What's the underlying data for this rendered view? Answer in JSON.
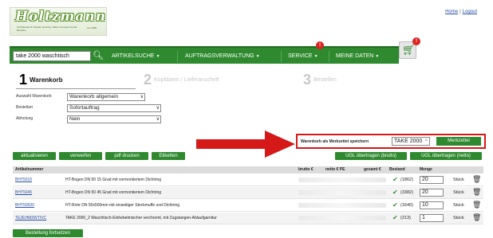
{
  "header": {
    "logo_text": "Holtzmann",
    "logo_tagline": "Großhandel für Sanitär, Heizung, Kälte und angrenzende Bereiche",
    "logo_year": "seit 1886",
    "links": {
      "home": "Home",
      "logout": "Logout"
    }
  },
  "nav": {
    "search_value": "take 2000 waschtisch",
    "items": [
      {
        "label": "ARTIKELSUCHE"
      },
      {
        "label": "AUFTRAGSVERWALTUNG"
      },
      {
        "label": "SERVICE"
      },
      {
        "label": "MEINE DATEN"
      }
    ],
    "service_badge": "!",
    "cart_badge": "!",
    "icons": {
      "search": "search-icon",
      "cart": "cart-icon",
      "dropdown": "caret-down-icon"
    }
  },
  "steps": [
    {
      "num": "1",
      "label": "Warenkorb",
      "active": true
    },
    {
      "num": "2",
      "label": "Kopfdaten / Lieferanschrift",
      "active": false
    },
    {
      "num": "3",
      "label": "Bestellen",
      "active": false
    }
  ],
  "form": {
    "auswahl": {
      "label": "Auswahl Warenkorb",
      "value": "Warenkorb allgemein"
    },
    "bestellart": {
      "label": "Bestellart",
      "value": "Sofortauftrag"
    },
    "abholung": {
      "label": "Abholung",
      "value": "Nein"
    }
  },
  "merkzettel": {
    "label": "Warenkorb als Merkzettel speichern",
    "input_value": "TAKE 2000",
    "clear_icon": "×",
    "button": "Merkzettel"
  },
  "actions": {
    "aktualisieren": "aktualisieren",
    "verwerfen": "verwerfen",
    "pdf": "pdf drucken",
    "etiketten": "Etiketten",
    "ugl_brutto": "UGL übertragen (brutto)",
    "ugl_netto": "UGL übertragen (netto)",
    "fortsetzen": "Bestellung fortsetzen"
  },
  "table": {
    "headers": {
      "artikelnummer": "Artikelnummer",
      "brutto": "brutto €",
      "netto": "netto € PE",
      "gesamt": "gesamt €",
      "bestand": "Bestand",
      "menge": "Menge"
    },
    "rows": [
      {
        "sku": "BHT5015",
        "desc": "HT-Bogen DN 50 15 Grad mit vormontiertem Dichtring",
        "stock": "(1862)",
        "qty": "20",
        "unit": "Stück"
      },
      {
        "sku": "BHT5045",
        "desc": "HT-Bogen DN 50 45 Grad mit vormontiertem Dichtring",
        "stock": "(3382)",
        "qty": "20",
        "unit": "Stück"
      },
      {
        "sku": "BHT50500",
        "desc": "HT-Rohr DN 50x500mm mit einseitiger Steckmuffe und Dichtring",
        "stock": "(1640)",
        "qty": "10",
        "unit": "Stück"
      },
      {
        "sku": "TE2EHM2WTIVC",
        "desc": "TAKE 2000_2 Waschtisch-Einhebelmischer verchromt, mit Zugstangen-Ablaufgarnitur",
        "stock": "(213)",
        "qty": "1",
        "unit": "Stück"
      }
    ]
  },
  "colors": {
    "brand_green": "#2f8a2f",
    "highlight_red": "#d51818",
    "link_blue": "#2b4fa0"
  }
}
